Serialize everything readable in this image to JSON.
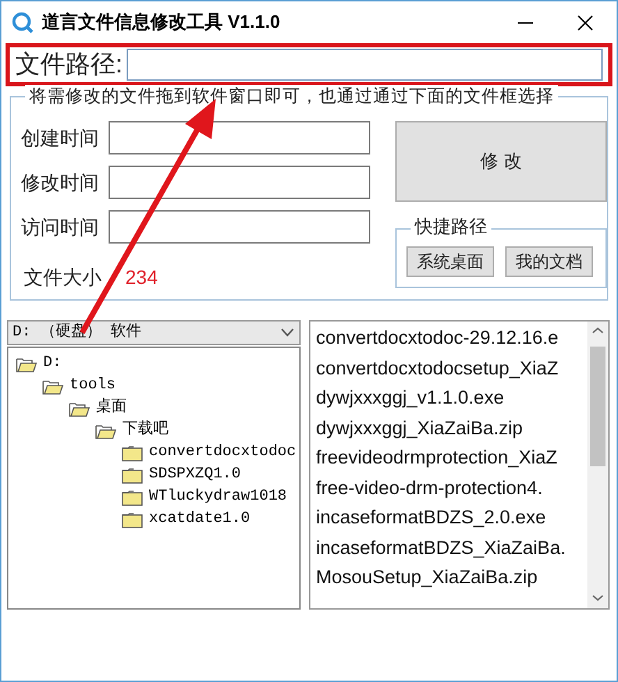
{
  "window": {
    "title": "道言文件信息修改工具 V1.1.0"
  },
  "path_field": {
    "label": "文件路径:",
    "highlighted": true
  },
  "group": {
    "title": "将需修改的文件拖到软件窗口即可，也通过通过下面的文件框选择",
    "fields": [
      {
        "label": "创建时间"
      },
      {
        "label": "修改时间"
      },
      {
        "label": "访问时间"
      }
    ],
    "size_label": "文件大小",
    "size_value": "234"
  },
  "modify_button": "修 改",
  "shortcuts": {
    "title": "快捷路径",
    "buttons": [
      "系统桌面",
      "我的文档"
    ]
  },
  "drive_select": {
    "value": "D: （硬盘） 软件"
  },
  "folder_tree": [
    {
      "label": "D:",
      "expanded": true,
      "children": [
        {
          "label": "tools",
          "expanded": true,
          "children": [
            {
              "label": "桌面",
              "expanded": true,
              "children": [
                {
                  "label": "下载吧",
                  "expanded": true,
                  "children": [
                    {
                      "label": "convertdocxtodoc",
                      "expanded": false
                    },
                    {
                      "label": "SDSPXZQ1.0",
                      "expanded": false
                    },
                    {
                      "label": "WTluckydraw1018",
                      "expanded": false
                    },
                    {
                      "label": "xcatdate1.0",
                      "expanded": false
                    }
                  ]
                }
              ]
            }
          ]
        }
      ]
    }
  ],
  "file_list": [
    "convertdocxtodoc-29.12.16.e",
    "convertdocxtodocsetup_XiaZ",
    "dywjxxxggj_v1.1.0.exe",
    "dywjxxxggj_XiaZaiBa.zip",
    "freevideodrmprotection_XiaZ",
    "free-video-drm-protection4.",
    "incaseformatBDZS_2.0.exe",
    "incaseformatBDZS_XiaZaiBa.",
    "MosouSetup_XiaZaiBa.zip"
  ]
}
